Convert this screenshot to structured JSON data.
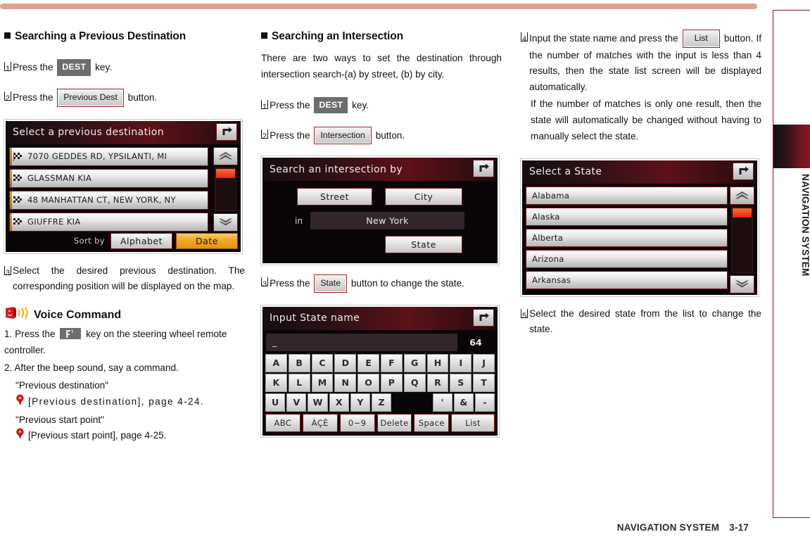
{
  "sidebar": {
    "label": "NAVIGATION SYSTEM"
  },
  "footer": {
    "label": "NAVIGATION SYSTEM",
    "page": "3-17"
  },
  "col1": {
    "heading": "Searching a Previous Destination",
    "step1": {
      "num": "1",
      "pre": "Press the",
      "chip": "DEST",
      "post": "key."
    },
    "step2": {
      "num": "2",
      "pre": "Press the",
      "chip": "Previous Dest",
      "post": "button."
    },
    "step3": {
      "num": "3",
      "text": "Select the desired previous destination. The corresponding position will be displayed on the map."
    },
    "screen": {
      "title": "Select a previous destination",
      "back_icon": "back-arrow-icon",
      "rows": [
        "7070 GEDDES RD, YPSILANTI, MI",
        "GLASSMAN KIA",
        "48 MANHATTAN CT, NEW YORK, NY",
        "GIUFFRE KIA"
      ],
      "sort_label": "Sort by",
      "sort_alphabet": "Alphabet",
      "sort_date": "Date",
      "scroll_up_icon": "chevron-up-icon",
      "scroll_down_icon": "chevron-down-icon"
    },
    "voice": {
      "icon": "voice-command-icon",
      "title": "Voice Command",
      "line1_pre": "1. Press the",
      "line1_chip_icon": "steering-wheel-voice-key-icon",
      "line1_post": "key on the steering wheel remote controller.",
      "line2": "2. After the beep sound, say a command.",
      "cmd1": "\"Previous destination\"",
      "ref1": "[Previous destination], page 4-24.",
      "cmd2": "\"Previous start point\"",
      "ref2": "[Previous start point], page 4-25.",
      "ref_icon": "voice-ref-icon"
    }
  },
  "col2": {
    "heading": "Searching an Intersection",
    "intro": "There are two ways to set the destination through intersection search-(a) by street, (b) by city.",
    "step1": {
      "num": "1",
      "pre": "Press the",
      "chip": "DEST",
      "post": "key."
    },
    "step2": {
      "num": "2",
      "pre": "Press the",
      "chip": "Intersection",
      "post": "button."
    },
    "step3": {
      "num": "3",
      "pre": "Press the",
      "chip": "State",
      "post": "button to change the state."
    },
    "ix_screen": {
      "title": "Search an intersection by",
      "back_icon": "back-arrow-icon",
      "street": "Street",
      "city": "City",
      "in_label": "in",
      "value": "New York",
      "state": "State"
    },
    "kb_screen": {
      "title": "Input State name",
      "back_icon": "back-arrow-icon",
      "input_value": "_",
      "count": "64",
      "row1": [
        "A",
        "B",
        "C",
        "D",
        "E",
        "F",
        "G",
        "H",
        "I",
        "J"
      ],
      "row2": [
        "K",
        "L",
        "M",
        "N",
        "O",
        "P",
        "Q",
        "R",
        "S",
        "T"
      ],
      "row3": [
        "U",
        "V",
        "W",
        "X",
        "Y",
        "Z",
        "",
        "",
        "'",
        "&",
        "-"
      ],
      "fn": [
        "ABC",
        "ÀÇÈ",
        "0~9",
        "Delete",
        "Space",
        "List"
      ]
    }
  },
  "col3": {
    "step4": {
      "num": "4",
      "pre": "Input the state name and press the",
      "chip": "List",
      "post": "button. If the number of matches with the input is less than 4  results, then the state list screen will be displayed automatically.",
      "para2": "If the number of matches is only one result, then the state will automatically be changed without having to manually select the state."
    },
    "screen": {
      "title": "Select a State",
      "back_icon": "back-arrow-icon",
      "rows": [
        "Alabama",
        "Alaska",
        "Alberta",
        "Arizona",
        "Arkansas"
      ],
      "scroll_up_icon": "chevron-up-icon",
      "scroll_down_icon": "chevron-down-icon"
    },
    "step5": {
      "num": "5",
      "text": "Select the desired state from the list to change the state."
    }
  },
  "colors": {
    "topbar": "#dfa191",
    "accent_red": "#8c1420",
    "chip_border": "#9b1c23",
    "active_orange": "#f0a828",
    "scroll_thumb": "#e02a12"
  }
}
